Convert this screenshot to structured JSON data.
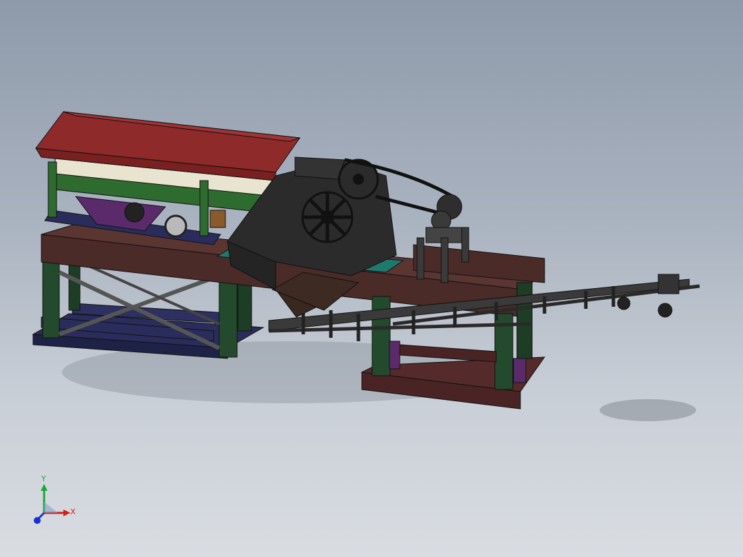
{
  "viewport": {
    "background_top": "#8e9aaa",
    "background_bottom": "#d9dde2"
  },
  "model": {
    "description_icon": "mobile-jaw-crusher-plant-3d-model",
    "colors": {
      "hopper": "#8f2a2a",
      "screen_frame": "#2e6b2e",
      "crusher": "#2b2b2b",
      "main_beam": "#4a2b28",
      "legs": "#234a2c",
      "base_blue": "#2a2d5c",
      "base_brown": "#4a2424",
      "conveyor": "#3a3a3a",
      "accent_teal": "#1f7a6e",
      "purple": "#5b2a6b"
    }
  },
  "triad": {
    "x_label": "X",
    "y_label": "Y",
    "x_color": "#d0221a",
    "y_color": "#1aa83a",
    "z_color": "#1a2fd0"
  }
}
